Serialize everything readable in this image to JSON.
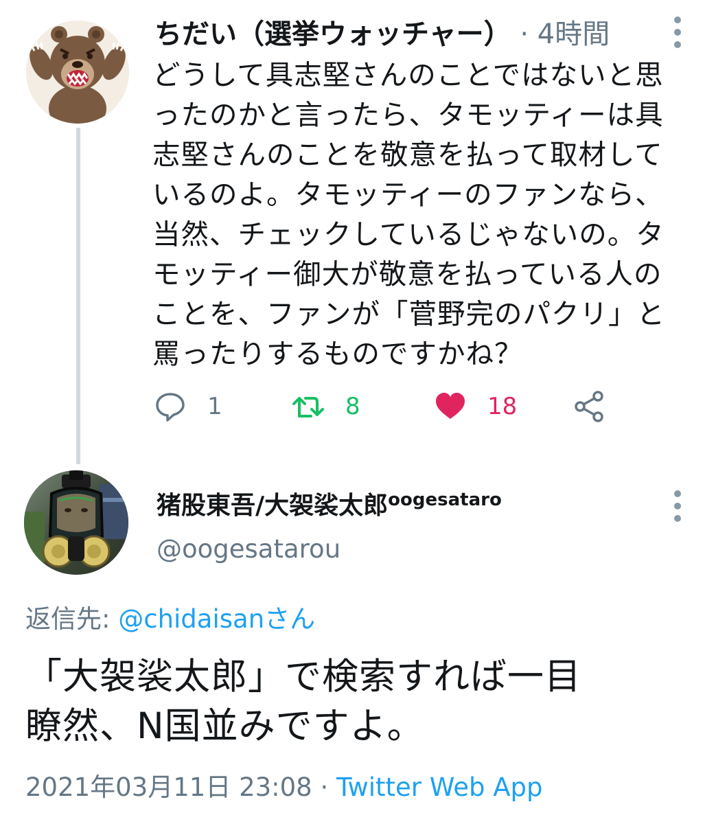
{
  "first_tweet": {
    "author_name": "ちだい（選挙ウォッチャー）",
    "separator": " · ",
    "time": "4時間",
    "body_lines": [
      "どうして具志堅さんのことではないと思",
      "ったのかと言ったら、タモッティーは具",
      "志堅さんのことを敬意を払って取材して",
      "いるのよ。タモッティーのファンなら、",
      "当然、チェックしているじゃないの。タ",
      "モッティー御大が敬意を払っている人の",
      "ことを、ファンが「菅野完のパクリ」と",
      "罵ったりするものですかね？"
    ],
    "actions": {
      "reply_count": "1",
      "retweet_count": "8",
      "like_count": "18"
    }
  },
  "reply_tweet": {
    "display_name": "猪股東吾/大袈裟太郎",
    "display_name_suffix": "oogesataro",
    "handle": "@oogesatarou",
    "reply_label": "返信先: ",
    "reply_mention": "@chidaisanさん",
    "body_lines": [
      "「大袈裟太郎」で検索すれば一目",
      "瞭然、N国並みですよ。"
    ],
    "timestamp": "2021年03月11日 23:08",
    "separator": " · ",
    "source": "Twitter Web App"
  },
  "icons": {
    "more": "more-vertical-icon",
    "reply": "reply-bubble-icon",
    "retweet": "retweet-icon",
    "like": "heart-icon",
    "share": "share-icon"
  },
  "colors": {
    "text": "#14171a",
    "secondary": "#657786",
    "link": "#1da1f2",
    "retweet": "#17bf63",
    "like": "#e0245e",
    "thread_line": "#cfd9de"
  }
}
